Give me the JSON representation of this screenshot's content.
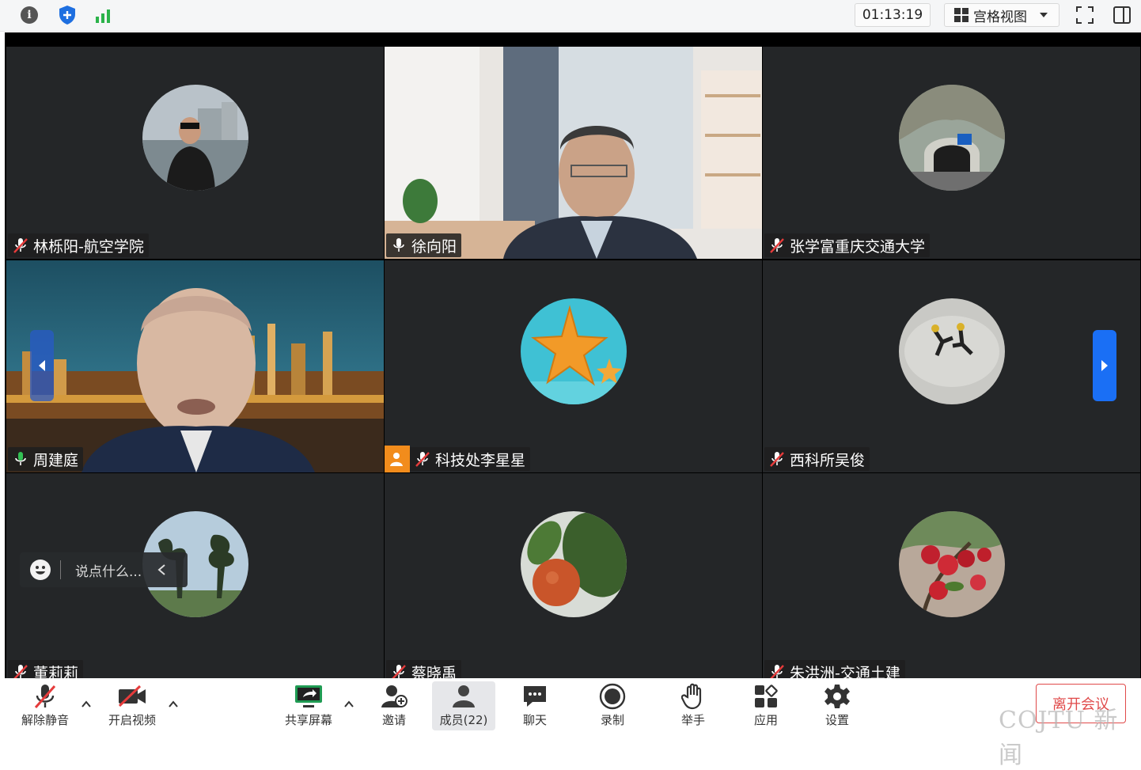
{
  "topbar": {
    "info_icon": "info-icon",
    "shield_icon": "shield-icon",
    "signal_icon": "signal-icon",
    "timer": "01:13:19",
    "view_mode": "宫格视图",
    "fullscreen_icon": "fullscreen-icon",
    "sidepanel_icon": "sidepanel-icon"
  },
  "tiles": [
    {
      "name": "林栎阳-航空学院",
      "muted": true,
      "video": false
    },
    {
      "name": "徐向阳",
      "muted": false,
      "video": true
    },
    {
      "name": "张学富重庆交通大学",
      "muted": true,
      "video": false
    },
    {
      "name": "周建庭",
      "muted": false,
      "speaking": true,
      "video": true
    },
    {
      "name": "科技处李星星",
      "muted": true,
      "host": true,
      "video": false
    },
    {
      "name": "西科所吴俊",
      "muted": true,
      "video": false
    },
    {
      "name": "董莉莉",
      "muted": true,
      "video": false
    },
    {
      "name": "蔡晓禹",
      "muted": true,
      "video": false
    },
    {
      "name": "朱洪洲-交通土建",
      "muted": true,
      "video": false
    }
  ],
  "chat": {
    "placeholder": "说点什么..."
  },
  "toolbar": {
    "unmute": "解除静音",
    "start_video": "开启视频",
    "share_screen": "共享屏幕",
    "invite": "邀请",
    "members": "成员(22)",
    "chat": "聊天",
    "record": "录制",
    "raise_hand": "举手",
    "apps": "应用",
    "settings": "设置",
    "leave": "离开会议"
  },
  "watermark": "COJTU 新闻",
  "colors": {
    "tile_bg": "#242628",
    "speaking_border": "#2f9d6c",
    "accent_blue": "#1a6ff5",
    "leave_red": "#e04a4a",
    "host_orange": "#f28c1c"
  }
}
